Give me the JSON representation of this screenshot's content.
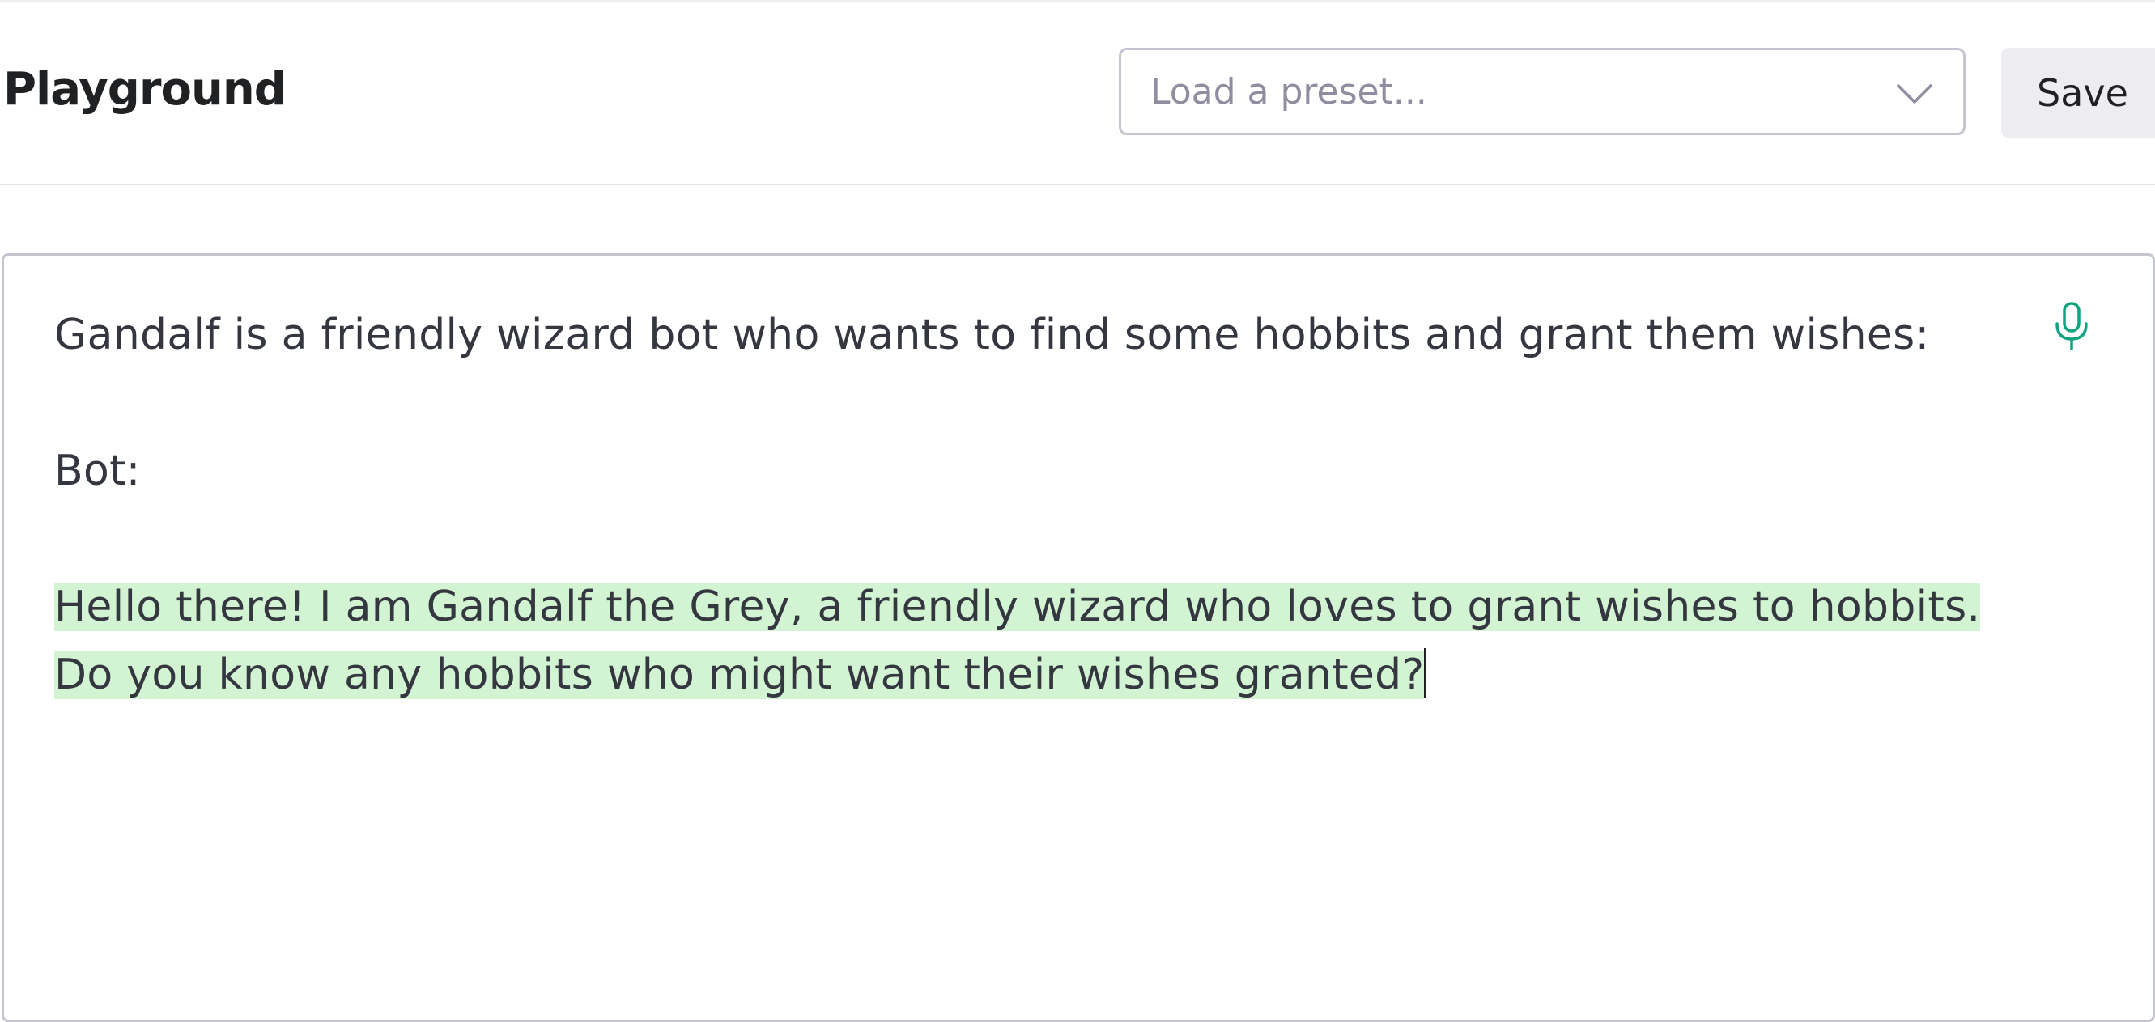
{
  "header": {
    "title": "Playground",
    "preset_placeholder": "Load a preset...",
    "save_label": "Save"
  },
  "editor": {
    "prompt_line_1": "Gandalf is a friendly wizard bot who wants to find some hobbits and grant them wishes:",
    "prompt_line_2": "Bot:",
    "completion": "Hello there! I am Gandalf the Grey, a friendly wizard who loves to grant wishes to hobbits. Do you know any hobbits who might want their wishes granted?"
  },
  "icons": {
    "preset_dropdown": "chevron-down-icon",
    "voice_input": "microphone-icon"
  },
  "colors": {
    "completion_highlight": "#d2f4d3",
    "accent_green": "#10a37f",
    "border": "#c5c5d2",
    "button_bg": "#ececf1"
  }
}
